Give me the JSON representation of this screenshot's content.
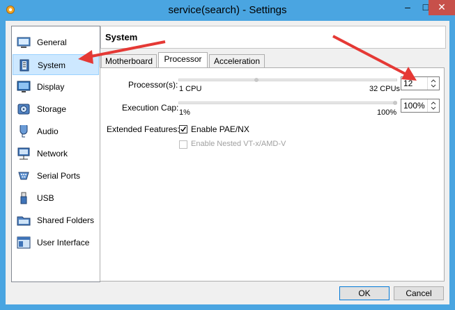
{
  "window": {
    "title": "service(search) - Settings",
    "minimize": "–",
    "maximize": "□",
    "close": "✕"
  },
  "sidebar": {
    "items": [
      {
        "label": "General",
        "icon": "general-icon"
      },
      {
        "label": "System",
        "icon": "system-icon",
        "selected": true
      },
      {
        "label": "Display",
        "icon": "display-icon"
      },
      {
        "label": "Storage",
        "icon": "storage-icon"
      },
      {
        "label": "Audio",
        "icon": "audio-icon"
      },
      {
        "label": "Network",
        "icon": "network-icon"
      },
      {
        "label": "Serial Ports",
        "icon": "serial-ports-icon"
      },
      {
        "label": "USB",
        "icon": "usb-icon"
      },
      {
        "label": "Shared Folders",
        "icon": "shared-folders-icon"
      },
      {
        "label": "User Interface",
        "icon": "user-interface-icon"
      }
    ]
  },
  "header": {
    "title": "System"
  },
  "tabs": [
    {
      "label": "Motherboard"
    },
    {
      "label": "Processor",
      "active": true
    },
    {
      "label": "Acceleration"
    }
  ],
  "processor": {
    "processors_label": "Processor(s):",
    "processors_min": "1 CPU",
    "processors_max": "32 CPUs",
    "processors_value": "12",
    "processors_fraction": 0.355,
    "exec_cap_label": "Execution Cap:",
    "exec_cap_min": "1%",
    "exec_cap_max": "100%",
    "exec_cap_value": "100%",
    "exec_cap_fraction": 1.0,
    "extended_label": "Extended Features:",
    "pae_label": "Enable PAE/NX",
    "pae_checked": true,
    "nested_label": "Enable Nested VT-x/AMD-V",
    "nested_checked": false,
    "nested_disabled": true
  },
  "buttons": {
    "ok": "OK",
    "cancel": "Cancel"
  },
  "colors": {
    "titlebar": "#4aa5e1",
    "close": "#c7504a",
    "annotation_arrow": "#e53935",
    "selected": "#cde8ff"
  }
}
